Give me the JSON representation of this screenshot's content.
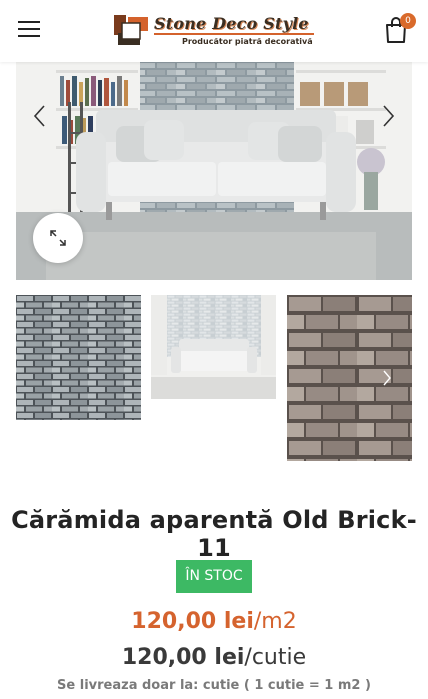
{
  "header": {
    "menu_icon": "hamburger-menu-icon",
    "logo": {
      "title": "Stone Deco Style",
      "subtitle": "Producător piatră decorativă"
    },
    "cart": {
      "icon": "shopping-bag-icon",
      "count": "0"
    }
  },
  "gallery": {
    "main_image_alt": "living room with grey brick wall and white sofa",
    "prev_icon": "chevron-left-icon",
    "next_icon": "chevron-right-icon",
    "zoom_icon": "expand-icon",
    "thumbnails": [
      "grey brick texture",
      "sofa with brick wall",
      "close-up brick texture"
    ]
  },
  "product": {
    "title": "Cărămida aparentă Old Brick-11",
    "stock": "ÎN STOC",
    "price_m2": {
      "amount": "120,00 lei",
      "unit": "/m2"
    },
    "price_box": {
      "amount": "120,00 lei",
      "unit": "/cutie"
    },
    "delivery_note": "Se livreaza doar la: cutie ( 1 cutie = 1 m2 )"
  },
  "colors": {
    "accent": "#d5632e",
    "stock_green": "#3db964",
    "badge": "#d96a2b"
  }
}
